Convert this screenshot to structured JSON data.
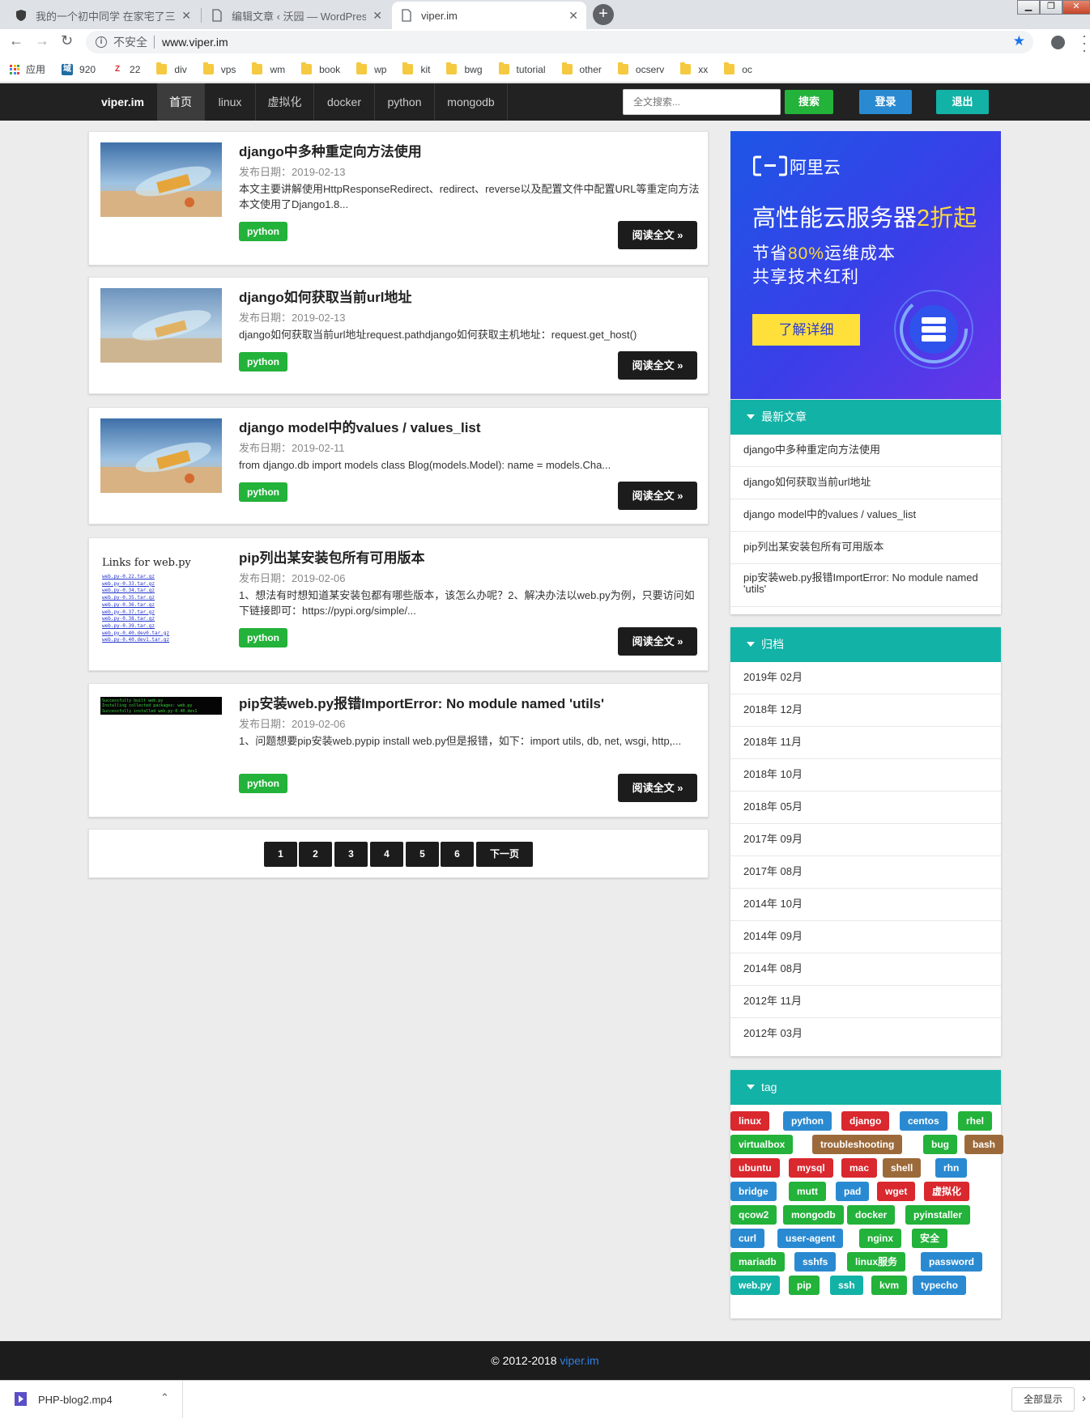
{
  "browser": {
    "tabs": [
      {
        "title": "我的一个初中同学 在家宅了三年",
        "close": "✕"
      },
      {
        "title": "编辑文章 ‹ 沃园 — WordPress",
        "close": "✕"
      },
      {
        "title": "viper.im",
        "close": "✕"
      }
    ],
    "new_tab": "+",
    "insecure_label": "不安全",
    "url": "www.viper.im",
    "bookmarks": [
      {
        "label": "应用",
        "icon": "apps-grid-icon"
      },
      {
        "label": "920",
        "icon": "domain-icon",
        "badge": "域"
      },
      {
        "label": "22",
        "icon": "z-icon",
        "badge": "Z"
      },
      {
        "label": "div",
        "icon": "folder-icon"
      },
      {
        "label": "vps",
        "icon": "folder-icon"
      },
      {
        "label": "wm",
        "icon": "folder-icon"
      },
      {
        "label": "book",
        "icon": "folder-icon"
      },
      {
        "label": "wp",
        "icon": "folder-icon"
      },
      {
        "label": "kit",
        "icon": "folder-icon"
      },
      {
        "label": "bwg",
        "icon": "folder-icon"
      },
      {
        "label": "tutorial",
        "icon": "folder-icon"
      },
      {
        "label": "other",
        "icon": "folder-icon"
      },
      {
        "label": "ocserv",
        "icon": "folder-icon"
      },
      {
        "label": "xx",
        "icon": "folder-icon"
      },
      {
        "label": "oc",
        "icon": "folder-icon"
      }
    ]
  },
  "site": {
    "brand": "viper.im",
    "nav": [
      "首页",
      "linux",
      "虚拟化",
      "docker",
      "python",
      "mongodb"
    ],
    "search_placeholder": "全文搜索...",
    "search_btn": "搜索",
    "login_btn": "登录",
    "logout_btn": "退出"
  },
  "posts": [
    {
      "title": "django中多种重定向方法使用",
      "date": "发布日期：2019-02-13",
      "excerpt": "本文主要讲解使用HttpResponseRedirect、redirect、reverse以及配置文件中配置URL等重定向方法本文使用了Django1.8...",
      "tag": "python",
      "read_more": "阅读全文 »"
    },
    {
      "title": "django如何获取当前url地址",
      "date": "发布日期：2019-02-13",
      "excerpt": "django如何获取当前url地址request.pathdjango如何获取主机地址：request.get_host()",
      "tag": "python",
      "read_more": "阅读全文 »"
    },
    {
      "title": "django model中的values / values_list",
      "date": "发布日期：2019-02-11",
      "excerpt": "from django.db import models class Blog(models.Model): name = models.Cha...",
      "tag": "python",
      "read_more": "阅读全文 »"
    },
    {
      "title": "pip列出某安装包所有可用版本",
      "date": "发布日期：2019-02-06",
      "excerpt": "1、想法有时想知道某安装包都有哪些版本，该怎么办呢？2、解决办法以web.py为例，只要访问如下链接即可：https://pypi.org/simple/...",
      "tag": "python",
      "read_more": "阅读全文 »"
    },
    {
      "title": "pip安装web.py报错ImportError: No module named 'utils'",
      "date": "发布日期：2019-02-06",
      "excerpt": "1、问题想要pip安装web.pypip install web.py但是报错，如下：import utils, db, net, wsgi, http,...",
      "tag": "python",
      "read_more": "阅读全文 »"
    }
  ],
  "thumb4": {
    "heading": "Links for web.py",
    "links": [
      "web.py-0.22.tar.gz",
      "web.py-0.33.tar.gz",
      "web.py-0.34.tar.gz",
      "web.py-0.35.tar.gz",
      "web.py-0.36.tar.gz",
      "web.py-0.37.tar.gz",
      "web.py-0.38.tar.gz",
      "web.py-0.39.tar.gz",
      "web.py-0.40.dev0.tar.gz",
      "web.py-0.40.dev1.tar.gz"
    ]
  },
  "thumb5": {
    "lines": [
      "Successfully built web.py",
      "Installing collected packages: web.py",
      "Successfully installed web.py-0.40.dev1"
    ]
  },
  "pagination": [
    "1",
    "2",
    "3",
    "4",
    "5",
    "6",
    "下一页"
  ],
  "ad": {
    "brand": "阿里云",
    "headline_a": "高性能云服务器",
    "headline_b": "2折起",
    "line1_a": "节省",
    "line1_b": "80%",
    "line1_c": "运维成本",
    "line2": "共享技术红利",
    "cta": "了解详细"
  },
  "recent": {
    "title": "最新文章",
    "items": [
      "django中多种重定向方法使用",
      "django如何获取当前url地址",
      "django model中的values / values_list",
      "pip列出某安装包所有可用版本",
      "pip安装web.py报错ImportError: No module named 'utils'"
    ]
  },
  "archive": {
    "title": "归档",
    "items": [
      "2019年 02月",
      "2018年 12月",
      "2018年 11月",
      "2018年 10月",
      "2018年 05月",
      "2017年 09月",
      "2017年 08月",
      "2014年 10月",
      "2014年 09月",
      "2014年 08月",
      "2012年 11月",
      "2012年 03月"
    ]
  },
  "tags": {
    "title": "tag",
    "colors": {
      "red": "#d9282e",
      "blue": "#2a8ad1",
      "green": "#23b23a",
      "brown": "#9c6a3a",
      "teal": "#13b2a6"
    },
    "rows": [
      [
        {
          "t": "linux",
          "c": "red"
        },
        {
          "t": "python",
          "c": "blue"
        },
        {
          "t": "django",
          "c": "red"
        },
        {
          "t": "centos",
          "c": "blue"
        },
        {
          "t": "rhel",
          "c": "green"
        }
      ],
      [
        {
          "t": "virtualbox",
          "c": "green"
        },
        {
          "t": "troubleshooting",
          "c": "brown"
        },
        {
          "t": "bug",
          "c": "green"
        },
        {
          "t": "bash",
          "c": "brown"
        }
      ],
      [
        {
          "t": "ubuntu",
          "c": "red"
        },
        {
          "t": "mysql",
          "c": "red"
        },
        {
          "t": "mac",
          "c": "red"
        },
        {
          "t": "shell",
          "c": "brown"
        },
        {
          "t": "rhn",
          "c": "blue"
        }
      ],
      [
        {
          "t": "bridge",
          "c": "blue"
        },
        {
          "t": "mutt",
          "c": "green"
        },
        {
          "t": "pad",
          "c": "blue"
        },
        {
          "t": "wget",
          "c": "red"
        },
        {
          "t": "虚拟化",
          "c": "red"
        }
      ],
      [
        {
          "t": "qcow2",
          "c": "green"
        },
        {
          "t": "mongodb",
          "c": "green"
        },
        {
          "t": "docker",
          "c": "green"
        },
        {
          "t": "pyinstaller",
          "c": "green"
        }
      ],
      [
        {
          "t": "curl",
          "c": "blue"
        },
        {
          "t": "user-agent",
          "c": "blue"
        },
        {
          "t": "nginx",
          "c": "green"
        },
        {
          "t": "安全",
          "c": "green"
        }
      ],
      [
        {
          "t": "mariadb",
          "c": "green"
        },
        {
          "t": "sshfs",
          "c": "blue"
        },
        {
          "t": "linux服务",
          "c": "green"
        },
        {
          "t": "password",
          "c": "blue"
        }
      ],
      [
        {
          "t": "web.py",
          "c": "teal"
        },
        {
          "t": "pip",
          "c": "green"
        },
        {
          "t": "ssh",
          "c": "teal"
        },
        {
          "t": "kvm",
          "c": "green"
        },
        {
          "t": "typecho",
          "c": "blue"
        }
      ]
    ]
  },
  "footer": {
    "copy": "© 2012-2018 ",
    "link": "viper.im"
  },
  "download": {
    "file": "PHP-blog2.mp4",
    "show_all": "全部显示"
  }
}
